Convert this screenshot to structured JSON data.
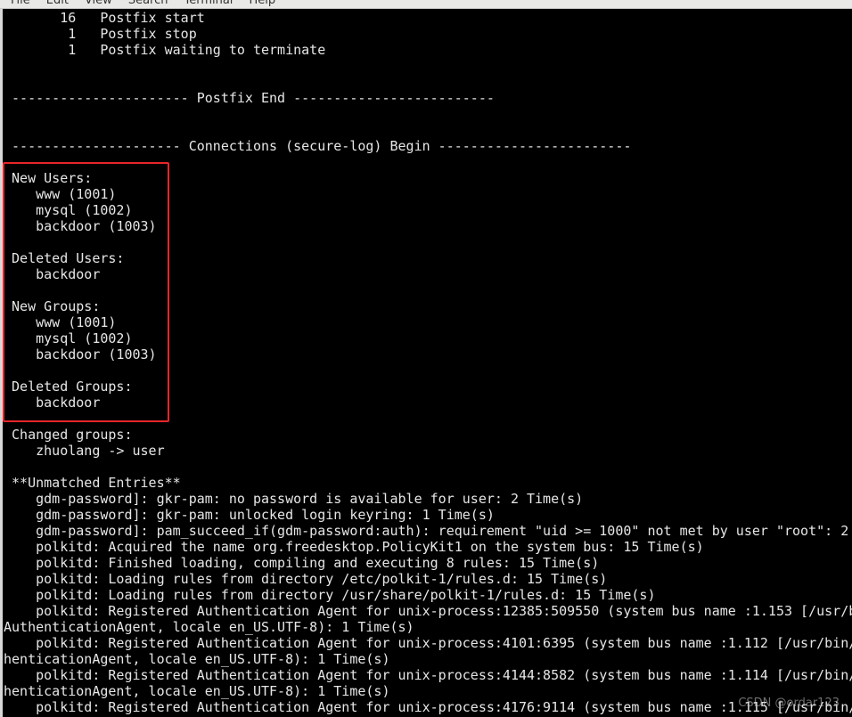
{
  "menu": [
    "File",
    "Edit",
    "View",
    "Search",
    "Terminal",
    "Help"
  ],
  "lines": [
    "       16   Postfix start",
    "        1   Postfix stop",
    "        1   Postfix waiting to terminate",
    "",
    "",
    " ---------------------- Postfix End -------------------------",
    "",
    "",
    " --------------------- Connections (secure-log) Begin ------------------------",
    "",
    " New Users:",
    "    www (1001)",
    "    mysql (1002)",
    "    backdoor (1003)",
    "",
    " Deleted Users:",
    "    backdoor",
    "",
    " New Groups:",
    "    www (1001)",
    "    mysql (1002)",
    "    backdoor (1003)",
    "",
    " Deleted Groups:",
    "    backdoor",
    "",
    " Changed groups:",
    "    zhuolang -> user",
    "",
    " **Unmatched Entries**",
    "    gdm-password]: gkr-pam: no password is available for user: 2 Time(s)",
    "    gdm-password]: gkr-pam: unlocked login keyring: 1 Time(s)",
    "    gdm-password]: pam_succeed_if(gdm-password:auth): requirement \"uid >= 1000\" not met by user \"root\": 2",
    "    polkitd: Acquired the name org.freedesktop.PolicyKit1 on the system bus: 15 Time(s)",
    "    polkitd: Finished loading, compiling and executing 8 rules: 15 Time(s)",
    "    polkitd: Loading rules from directory /etc/polkit-1/rules.d: 15 Time(s)",
    "    polkitd: Loading rules from directory /usr/share/polkit-1/rules.d: 15 Time(s)",
    "    polkitd: Registered Authentication Agent for unix-process:12385:509550 (system bus name :1.153 [/usr/b",
    "AuthenticationAgent, locale en_US.UTF-8): 1 Time(s)",
    "    polkitd: Registered Authentication Agent for unix-process:4101:6395 (system bus name :1.112 [/usr/bin/",
    "henticationAgent, locale en_US.UTF-8): 1 Time(s)",
    "    polkitd: Registered Authentication Agent for unix-process:4144:8582 (system bus name :1.114 [/usr/bin/",
    "henticationAgent, locale en_US.UTF-8): 1 Time(s)",
    "    polkitd: Registered Authentication Agent for unix-process:4176:9114 (system bus name :1.115 [/usr/bin/"
  ],
  "highlight_color": "#e8262a",
  "watermark": "CSDN @ordar123"
}
